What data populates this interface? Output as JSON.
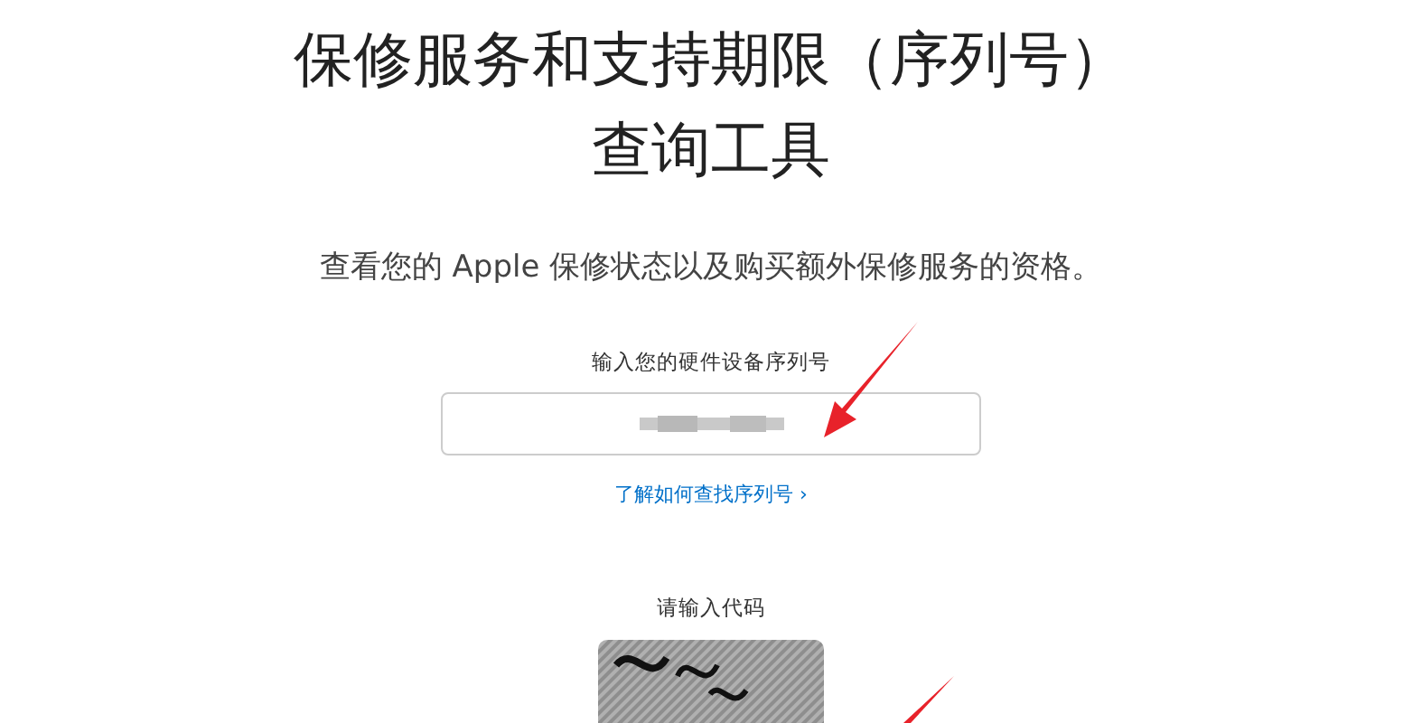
{
  "title": [
    "保修服务和支持期限（序列号）",
    "查询工具"
  ],
  "subtitle": "查看您的 Apple 保修状态以及购买额外保修服务的资格。",
  "serial": {
    "label": "输入您的硬件设备序列号"
  },
  "help_link": "了解如何查找序列号 ›",
  "captcha": {
    "label": "请输入代码",
    "kind": "picture"
  }
}
